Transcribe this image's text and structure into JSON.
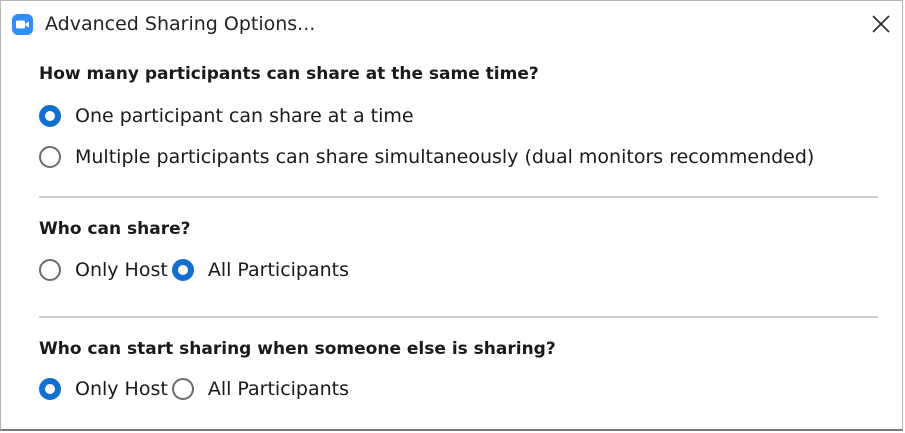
{
  "window": {
    "title": "Advanced Sharing Options..."
  },
  "sections": [
    {
      "question": "How many participants can share at the same time?",
      "options": [
        {
          "label": "One participant can share at a time",
          "checked": true
        },
        {
          "label": "Multiple participants can share simultaneously (dual monitors recommended)",
          "checked": false
        }
      ]
    },
    {
      "question": "Who can share?",
      "options": [
        {
          "label": "Only Host",
          "checked": false
        },
        {
          "label": "All Participants",
          "checked": true
        }
      ]
    },
    {
      "question": "Who can start sharing when someone else is sharing?",
      "options": [
        {
          "label": "Only Host",
          "checked": true
        },
        {
          "label": "All Participants",
          "checked": false
        }
      ]
    }
  ],
  "colors": {
    "accent": "#1170cf",
    "app_icon": "#2d8cff"
  },
  "icons": {
    "app": "zoom-camera-icon",
    "close": "close-icon"
  }
}
